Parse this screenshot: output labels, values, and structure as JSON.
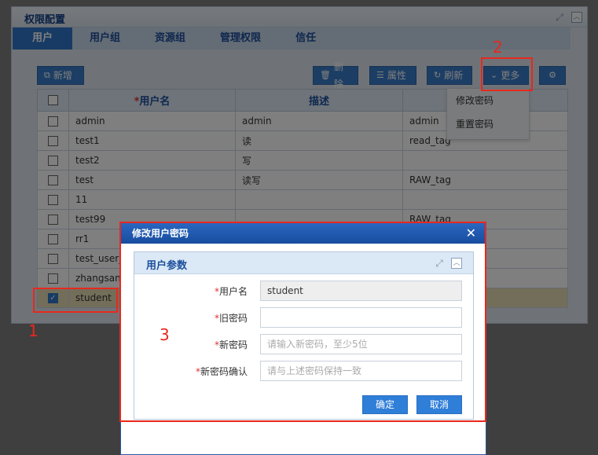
{
  "panel": {
    "title": "权限配置"
  },
  "tabs": [
    {
      "label": "用户"
    },
    {
      "label": "用户组"
    },
    {
      "label": "资源组"
    },
    {
      "label": "管理权限"
    },
    {
      "label": "信任"
    }
  ],
  "toolbar": {
    "add_label": "新增",
    "delete_label": "删除",
    "properties_label": "属性",
    "refresh_label": "刷新",
    "more_label": "更多"
  },
  "table": {
    "headers": {
      "required_mark": "*",
      "username": "用户名",
      "description": "描述"
    },
    "rows": [
      {
        "username": "admin",
        "description": "admin",
        "extra": "admin"
      },
      {
        "username": "test1",
        "description": "读",
        "extra": "read_tag"
      },
      {
        "username": "test2",
        "description": "写",
        "extra": ""
      },
      {
        "username": "test",
        "description": "读写",
        "extra": "RAW_tag"
      },
      {
        "username": "11",
        "description": "",
        "extra": ""
      },
      {
        "username": "test99",
        "description": "",
        "extra": "RAW_tag"
      },
      {
        "username": "rr1",
        "description": "",
        "extra": ""
      },
      {
        "username": "test_user_",
        "description": "",
        "extra": ""
      },
      {
        "username": "zhangsan",
        "description": "",
        "extra": ""
      },
      {
        "username": "student",
        "description": "",
        "extra": ""
      }
    ]
  },
  "dropdown": {
    "items": [
      {
        "label": "修改密码"
      },
      {
        "label": "重置密码"
      }
    ]
  },
  "annotations": {
    "one": "1",
    "two": "2",
    "three": "3"
  },
  "dialog": {
    "title": "修改用户密码",
    "close_symbol": "✕",
    "section_title": "用户参数",
    "required_mark": "*",
    "fields": {
      "username_label": "用户名",
      "username_value": "student",
      "old_password_label": "旧密码",
      "old_password_value": "",
      "new_password_label": "新密码",
      "new_password_placeholder": "请输入新密码，至少5位",
      "confirm_label": "新密码确认",
      "confirm_placeholder": "请与上述密码保持一致"
    },
    "ok_label": "确定",
    "cancel_label": "取消"
  },
  "colors": {
    "accent": "#2f77c9",
    "highlight": "#e8281e",
    "selected_row": "#e6dcb3"
  }
}
